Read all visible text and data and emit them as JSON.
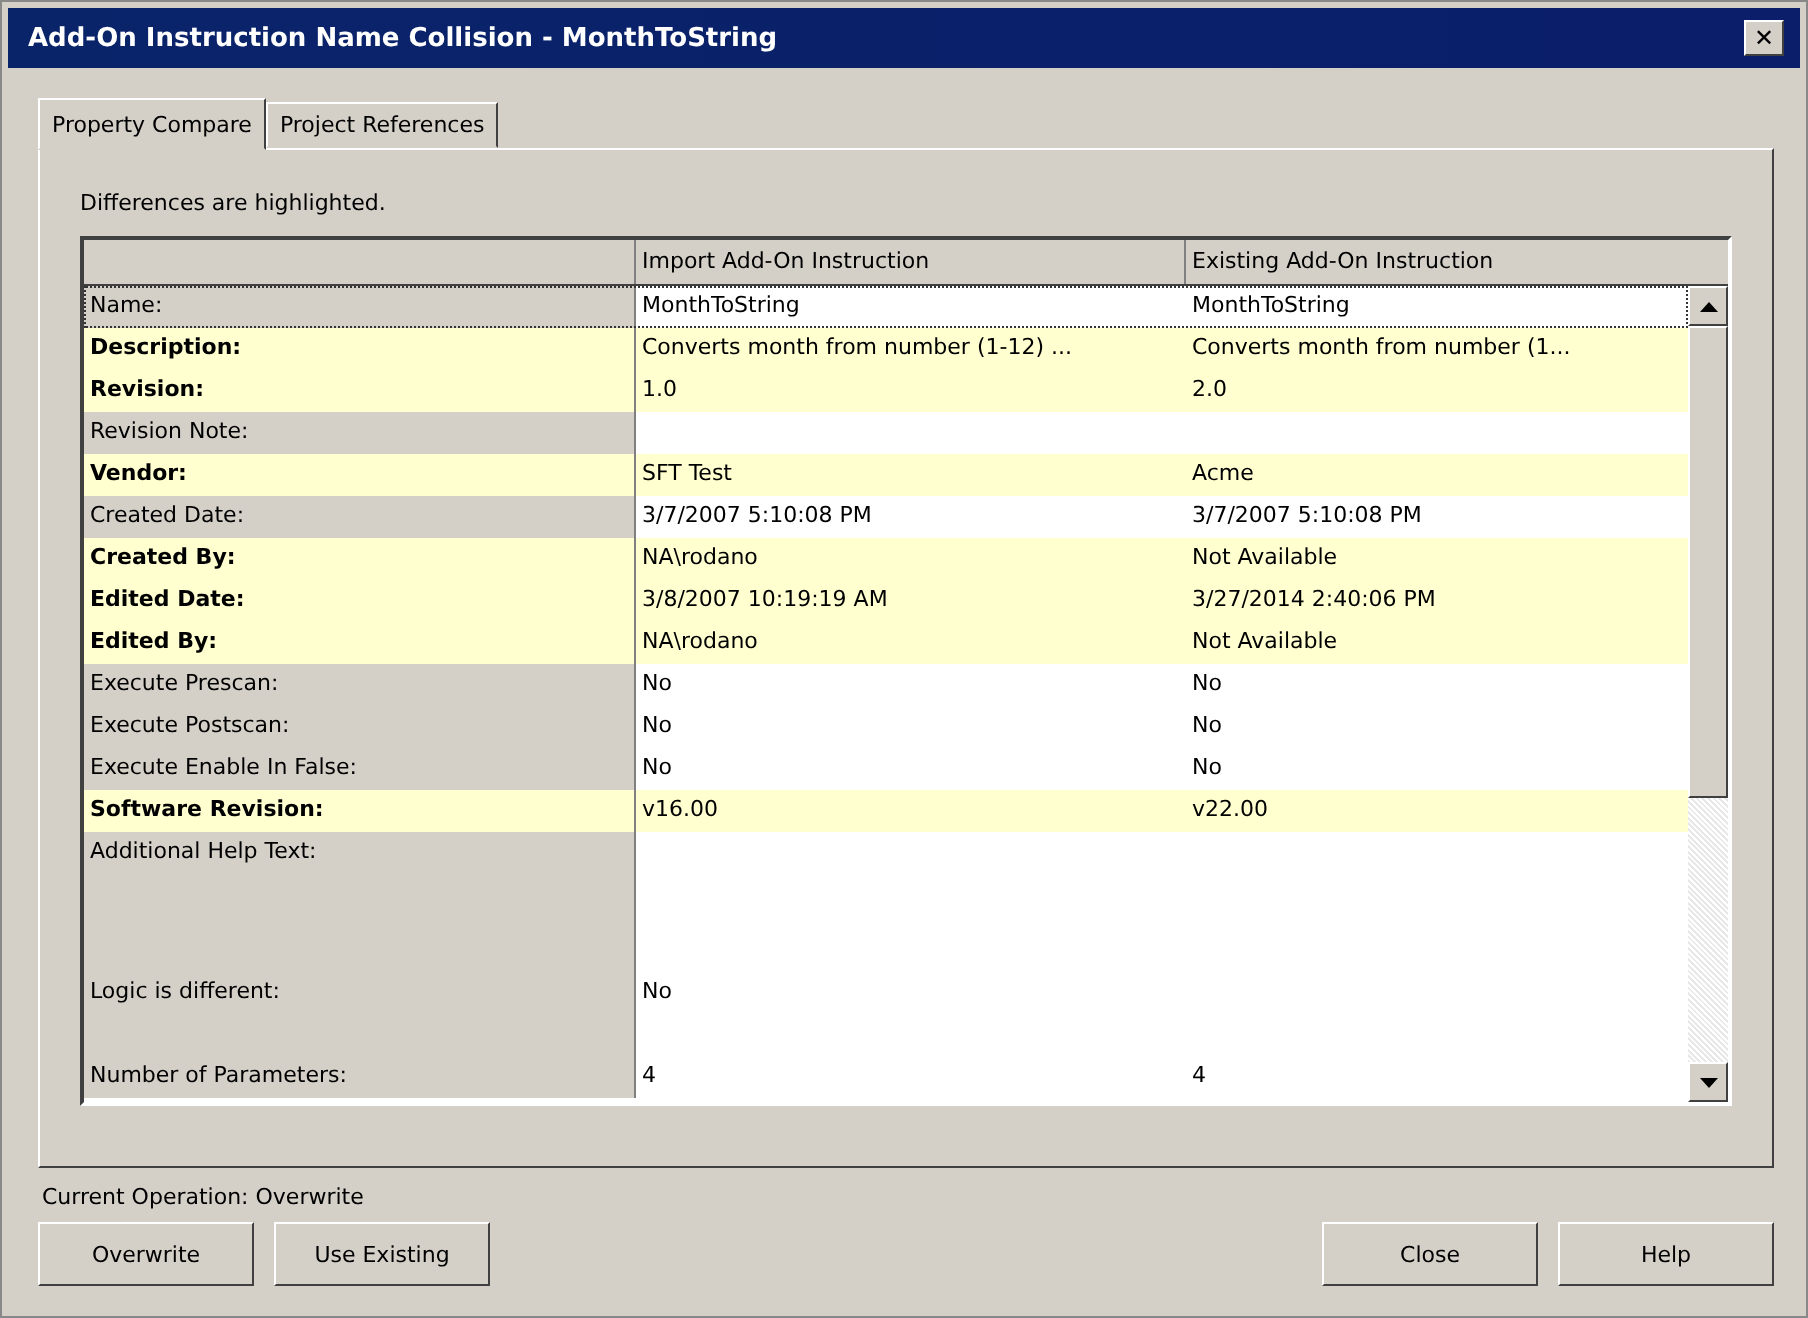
{
  "window": {
    "title": "Add-On Instruction Name Collision - MonthToString",
    "close_glyph": "✕"
  },
  "tabs": [
    {
      "label": "Property Compare",
      "selected": true
    },
    {
      "label": "Project References",
      "selected": false
    }
  ],
  "hint": "Differences are highlighted.",
  "table": {
    "columns": [
      "Import Add-On Instruction",
      "Existing Add-On Instruction"
    ],
    "rows": [
      {
        "label": "Name:",
        "import": "MonthToString",
        "existing": "MonthToString",
        "different": false,
        "selected": true
      },
      {
        "label": "Description:",
        "import": "Converts month from number (1-12) ...",
        "existing": "Converts month from number (1...",
        "different": true,
        "selected": false
      },
      {
        "label": "Revision:",
        "import": "1.0",
        "existing": "2.0",
        "different": true,
        "selected": false
      },
      {
        "label": "Revision Note:",
        "different": false,
        "selected": false
      },
      {
        "label": "Vendor:",
        "import": "SFT Test",
        "existing": "Acme",
        "different": true,
        "selected": false
      },
      {
        "label": "Created Date:",
        "import": "3/7/2007  5:10:08 PM",
        "existing": "3/7/2007  5:10:08 PM",
        "different": false,
        "selected": false
      },
      {
        "label": "Created By:",
        "import": "NA\\rodano",
        "existing": "Not Available",
        "different": true,
        "selected": false
      },
      {
        "label": "Edited Date:",
        "import": "3/8/2007  10:19:19 AM",
        "existing": "3/27/2014  2:40:06 PM",
        "different": true,
        "selected": false
      },
      {
        "label": "Edited By:",
        "import": "NA\\rodano",
        "existing": "Not Available",
        "different": true,
        "selected": false
      },
      {
        "label": "Execute Prescan:",
        "import": "No",
        "existing": "No",
        "different": false,
        "selected": false
      },
      {
        "label": "Execute Postscan:",
        "import": "No",
        "existing": "No",
        "different": false,
        "selected": false
      },
      {
        "label": "Execute Enable In False:",
        "import": "No",
        "existing": "No",
        "different": false,
        "selected": false
      },
      {
        "label": "Software Revision:",
        "import": "v16.00",
        "existing": "v22.00",
        "different": true,
        "selected": false
      },
      {
        "label": "Additional Help Text:",
        "kind": "multiline",
        "different": false,
        "selected": false
      },
      {
        "label": "Logic is different:",
        "import": "No",
        "kind": "centered",
        "different": false,
        "selected": false
      },
      {
        "label": "Number of Parameters:",
        "import": "4",
        "existing": "4",
        "different": false,
        "selected": false
      }
    ]
  },
  "status": "Current Operation: Overwrite",
  "left_buttons": [
    "Overwrite",
    "Use Existing"
  ],
  "right_buttons": [
    "Close",
    "Help"
  ]
}
